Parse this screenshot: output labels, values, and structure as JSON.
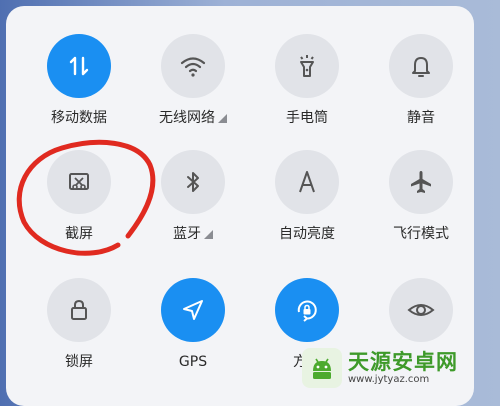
{
  "tiles": [
    {
      "label": "移动数据",
      "icon": "mobile-data-icon",
      "on": true
    },
    {
      "label": "无线网络",
      "icon": "wifi-icon",
      "on": false,
      "has_menu": true
    },
    {
      "label": "手电筒",
      "icon": "flashlight-icon",
      "on": false
    },
    {
      "label": "静音",
      "icon": "bell-icon",
      "on": false
    },
    {
      "label": "截屏",
      "icon": "screenshot-icon",
      "on": false
    },
    {
      "label": "蓝牙",
      "icon": "bluetooth-icon",
      "on": false,
      "has_menu": true
    },
    {
      "label": "自动亮度",
      "icon": "auto-brightness-icon",
      "on": false
    },
    {
      "label": "飞行模式",
      "icon": "airplane-icon",
      "on": false
    },
    {
      "label": "锁屏",
      "icon": "lock-icon",
      "on": false
    },
    {
      "label": "GPS",
      "icon": "location-arrow-icon",
      "on": true
    },
    {
      "label": "方向",
      "icon": "rotation-lock-icon",
      "on": true
    },
    {
      "label": "",
      "icon": "eye-icon",
      "on": false
    }
  ],
  "colors": {
    "active": "#1a8ff2",
    "inactive": "#e1e3e8",
    "annotation": "#e02a20"
  },
  "watermark": {
    "title": "天源安卓网",
    "url": "www.jytyaz.com"
  }
}
